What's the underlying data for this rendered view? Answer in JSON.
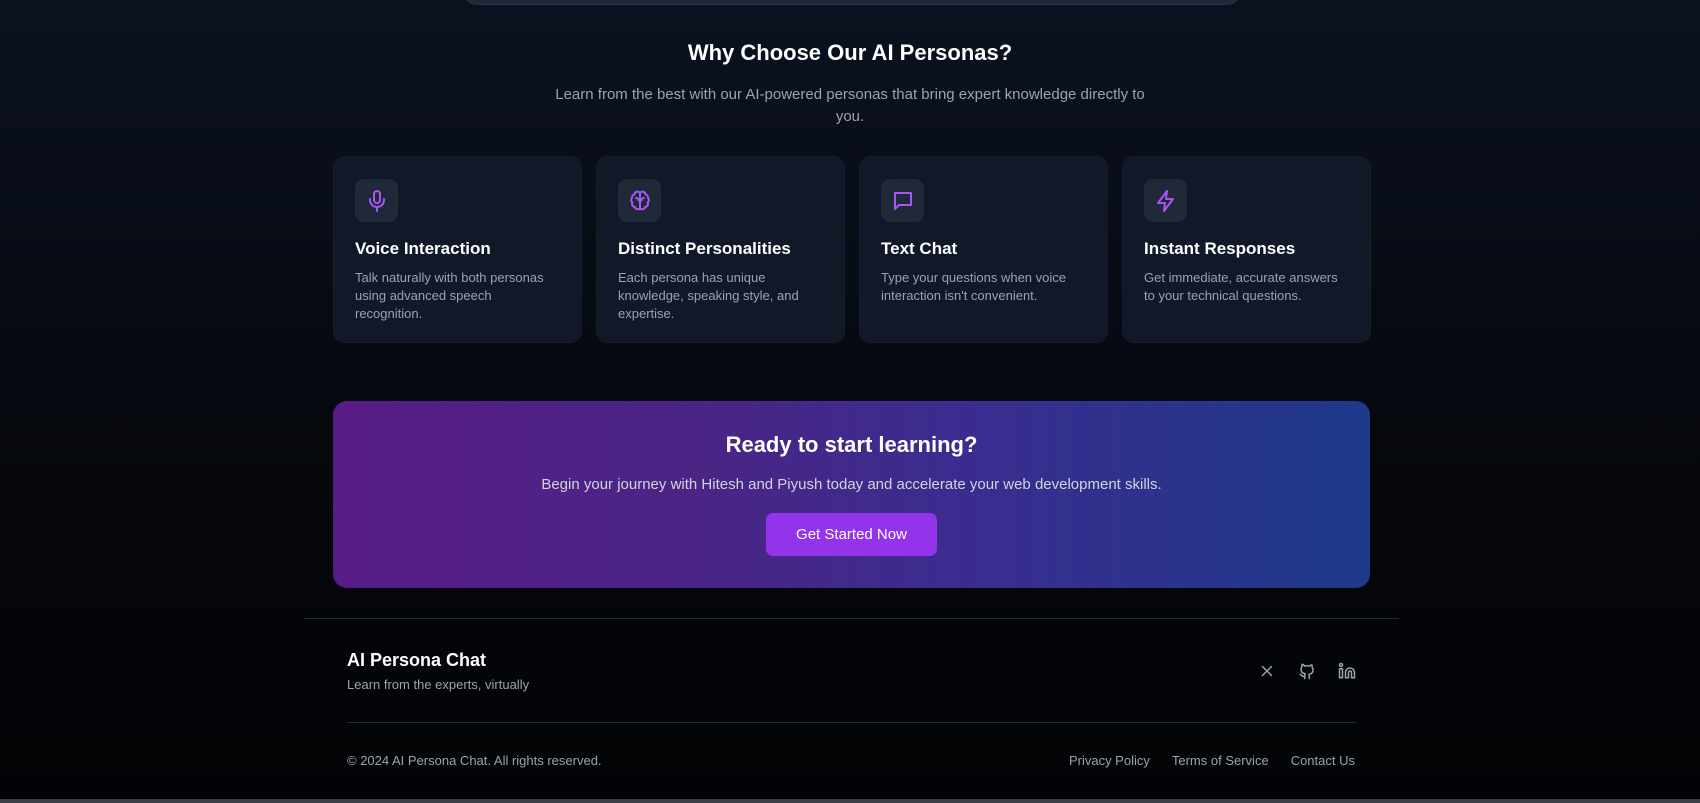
{
  "features": {
    "title": "Why Choose Our AI Personas?",
    "subtitle": "Learn from the best with our AI-powered personas that bring expert knowledge directly to you.",
    "cards": [
      {
        "icon": "microphone-icon",
        "title": "Voice Interaction",
        "desc": "Talk naturally with both personas using advanced speech recognition."
      },
      {
        "icon": "brain-icon",
        "title": "Distinct Personalities",
        "desc": "Each persona has unique knowledge, speaking style, and expertise."
      },
      {
        "icon": "chat-bubble-icon",
        "title": "Text Chat",
        "desc": "Type your questions when voice interaction isn't convenient."
      },
      {
        "icon": "lightning-icon",
        "title": "Instant Responses",
        "desc": "Get immediate, accurate answers to your technical questions."
      }
    ]
  },
  "cta": {
    "title": "Ready to start learning?",
    "subtitle": "Begin your journey with Hitesh and Piyush today and accelerate your web development skills.",
    "button_label": "Get Started Now"
  },
  "footer": {
    "brand": "AI Persona Chat",
    "tagline": "Learn from the experts, virtually",
    "socials": [
      "x-icon",
      "github-icon",
      "linkedin-icon"
    ],
    "copyright": "© 2024 AI Persona Chat. All rights reserved.",
    "links": [
      "Privacy Policy",
      "Terms of Service",
      "Contact Us"
    ]
  },
  "colors": {
    "accent": "#9333ea",
    "icon": "#a855f7",
    "card_bg": "#111827",
    "cta_gradient_start": "#581c87",
    "cta_gradient_end": "#1e3a8a"
  }
}
